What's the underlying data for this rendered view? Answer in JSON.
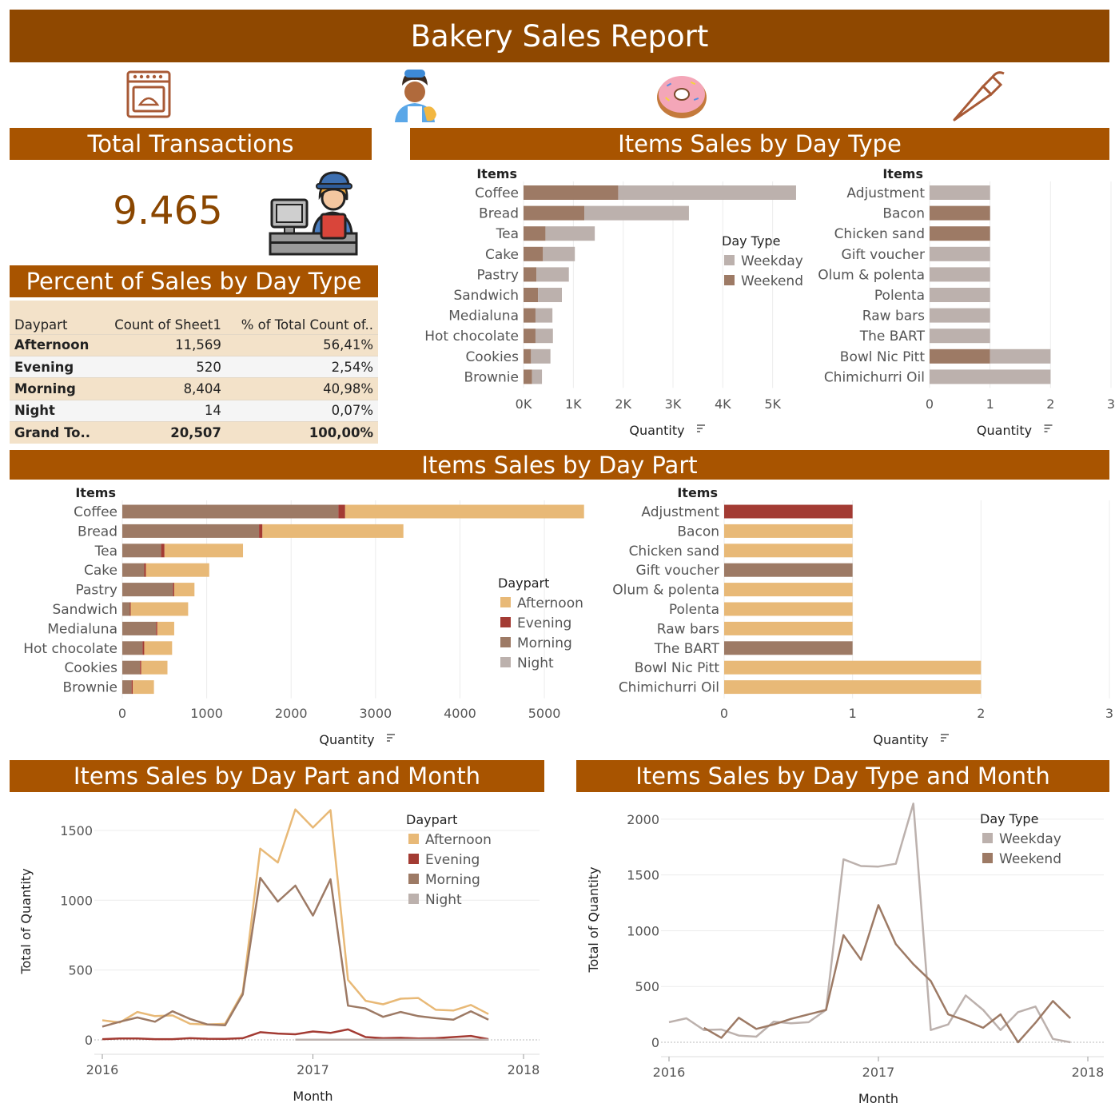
{
  "title": "Bakery Sales Report",
  "icons": [
    "oven-icon",
    "baker-icon",
    "donut-icon",
    "piping-bag-icon",
    "cashier-icon"
  ],
  "colors": {
    "banner": "#a85400",
    "title_banner": "#8f4800",
    "weekday": "#bcb1ad",
    "weekend": "#9d7a65",
    "afternoon": "#e8b977",
    "evening": "#a33b33",
    "morning": "#9d7a65",
    "night": "#bcb1ad"
  },
  "total_transactions": {
    "heading": "Total Transactions",
    "value": "9.465"
  },
  "percent_table": {
    "heading": "Percent of Sales by Day Type",
    "columns": [
      "Daypart",
      "Count of Sheet1",
      "% of Total Count of.."
    ],
    "rows": [
      [
        "Afternoon",
        "11,569",
        "56,41%"
      ],
      [
        "Evening",
        "520",
        "2,54%"
      ],
      [
        "Morning",
        "8,404",
        "40,98%"
      ],
      [
        "Night",
        "14",
        "0,07%"
      ],
      [
        "Grand To..",
        "20,507",
        "100,00%"
      ]
    ]
  },
  "headings": {
    "day_type": "Items Sales by Day Type",
    "day_part": "Items Sales by Day Part",
    "part_month": "Items Sales by Day Part and Month",
    "type_month": "Items Sales by Day Type and Month"
  },
  "chart_data": [
    {
      "id": "daytype-top",
      "type": "bar",
      "orientation": "horizontal",
      "stacked": true,
      "row_header": "Items",
      "categories": [
        "Coffee",
        "Bread",
        "Tea",
        "Cake",
        "Pastry",
        "Sandwich",
        "Medialuna",
        "Hot chocolate",
        "Cookies",
        "Brownie"
      ],
      "series": [
        {
          "name": "Weekend",
          "color_key": "weekend",
          "values": [
            1900,
            1220,
            440,
            390,
            260,
            290,
            240,
            240,
            150,
            170
          ]
        },
        {
          "name": "Weekday",
          "color_key": "weekday",
          "values": [
            3570,
            2100,
            990,
            640,
            650,
            480,
            340,
            350,
            390,
            200
          ]
        }
      ],
      "xlabel": "Quantity",
      "xlim": [
        0,
        6000
      ],
      "ticks": [
        0,
        1000,
        2000,
        3000,
        4000,
        5000
      ],
      "tick_labels": [
        "0K",
        "1K",
        "2K",
        "3K",
        "4K",
        "5K"
      ],
      "legend": {
        "title": "Day Type",
        "entries": [
          "Weekday",
          "Weekend"
        ],
        "placement": "right"
      }
    },
    {
      "id": "daytype-bottom",
      "type": "bar",
      "orientation": "horizontal",
      "stacked": true,
      "row_header": "Items",
      "categories": [
        "Adjustment",
        "Bacon",
        "Chicken sand",
        "Gift voucher",
        "Olum & polenta",
        "Polenta",
        "Raw bars",
        "The BART",
        "Bowl Nic Pitt",
        "Chimichurri Oil"
      ],
      "series": [
        {
          "name": "Weekend",
          "color_key": "weekend",
          "values": [
            0,
            1,
            1,
            0,
            0,
            0,
            0,
            0,
            1,
            0
          ]
        },
        {
          "name": "Weekday",
          "color_key": "weekday",
          "values": [
            1,
            0,
            0,
            1,
            1,
            1,
            1,
            1,
            1,
            2
          ]
        }
      ],
      "xlabel": "Quantity",
      "xlim": [
        0,
        3
      ],
      "ticks": [
        0,
        1,
        2,
        3
      ],
      "tick_labels": [
        "0",
        "1",
        "2",
        "3"
      ]
    },
    {
      "id": "daypart-top",
      "type": "bar",
      "orientation": "horizontal",
      "stacked": true,
      "row_header": "Items",
      "categories": [
        "Coffee",
        "Bread",
        "Tea",
        "Cake",
        "Pastry",
        "Sandwich",
        "Medialuna",
        "Hot chocolate",
        "Cookies",
        "Brownie"
      ],
      "series": [
        {
          "name": "Morning",
          "color_key": "morning",
          "values": [
            2560,
            1620,
            460,
            260,
            600,
            90,
            400,
            240,
            210,
            110
          ]
        },
        {
          "name": "Evening",
          "color_key": "evening",
          "values": [
            80,
            40,
            40,
            20,
            15,
            10,
            15,
            20,
            15,
            15
          ]
        },
        {
          "name": "Afternoon",
          "color_key": "afternoon",
          "values": [
            2830,
            1670,
            930,
            750,
            240,
            680,
            200,
            330,
            310,
            250
          ]
        },
        {
          "name": "Night",
          "color_key": "night",
          "values": [
            0,
            0,
            0,
            0,
            0,
            0,
            0,
            0,
            0,
            0
          ]
        }
      ],
      "xlabel": "Quantity",
      "xlim": [
        0,
        5700
      ],
      "ticks": [
        0,
        1000,
        2000,
        3000,
        4000,
        5000
      ],
      "tick_labels": [
        "0",
        "1000",
        "2000",
        "3000",
        "4000",
        "5000"
      ],
      "legend": {
        "title": "Daypart",
        "entries": [
          "Afternoon",
          "Evening",
          "Morning",
          "Night"
        ],
        "placement": "right"
      }
    },
    {
      "id": "daypart-bottom",
      "type": "bar",
      "orientation": "horizontal",
      "stacked": true,
      "row_header": "Items",
      "categories": [
        "Adjustment",
        "Bacon",
        "Chicken sand",
        "Gift voucher",
        "Olum & polenta",
        "Polenta",
        "Raw bars",
        "The BART",
        "Bowl Nic Pitt",
        "Chimichurri Oil"
      ],
      "series": [
        {
          "name": "Evening",
          "color_key": "evening",
          "values": [
            1,
            0,
            0,
            0,
            0,
            0,
            0,
            0,
            0,
            0
          ]
        },
        {
          "name": "Morning",
          "color_key": "morning",
          "values": [
            0,
            0,
            0,
            1,
            0,
            0,
            0,
            1,
            0,
            0
          ]
        },
        {
          "name": "Afternoon",
          "color_key": "afternoon",
          "values": [
            0,
            1,
            1,
            0,
            1,
            1,
            1,
            0,
            2,
            2
          ]
        }
      ],
      "xlabel": "Quantity",
      "xlim": [
        0,
        3
      ],
      "ticks": [
        0,
        1,
        2,
        3
      ],
      "tick_labels": [
        "0",
        "1",
        "2",
        "3"
      ]
    },
    {
      "id": "part-month",
      "type": "line",
      "x": [
        "2016-01",
        "2016-02",
        "2016-03",
        "2016-04",
        "2016-05",
        "2016-06",
        "2016-07",
        "2016-08",
        "2016-09",
        "2016-10",
        "2016-11",
        "2016-12",
        "2017-01",
        "2017-02",
        "2017-03",
        "2017-04",
        "2017-05",
        "2017-06",
        "2017-07",
        "2017-08",
        "2017-09",
        "2017-10",
        "2017-11",
        "2017-12",
        "2018-01"
      ],
      "series": [
        {
          "name": "Afternoon",
          "color_key": "afternoon",
          "values": [
            140,
            125,
            200,
            170,
            175,
            115,
            110,
            115,
            340,
            1370,
            1270,
            1650,
            1520,
            1645,
            430,
            280,
            255,
            295,
            300,
            215,
            210,
            250,
            185,
            null,
            null
          ]
        },
        {
          "name": "Evening",
          "color_key": "evening",
          "values": [
            5,
            10,
            10,
            5,
            5,
            12,
            8,
            7,
            12,
            55,
            45,
            40,
            60,
            50,
            75,
            20,
            12,
            15,
            10,
            12,
            20,
            28,
            5,
            null,
            null
          ]
        },
        {
          "name": "Morning",
          "color_key": "morning",
          "values": [
            95,
            130,
            160,
            130,
            205,
            150,
            110,
            105,
            325,
            1160,
            990,
            1105,
            890,
            1150,
            245,
            225,
            165,
            200,
            170,
            155,
            145,
            205,
            145,
            null,
            null
          ]
        },
        {
          "name": "Night",
          "color_key": "night",
          "values": [
            null,
            null,
            null,
            null,
            null,
            null,
            null,
            null,
            null,
            null,
            null,
            2,
            2,
            2,
            2,
            2,
            2,
            2,
            2,
            2,
            2,
            2,
            2,
            null,
            null
          ]
        }
      ],
      "xlabel": "Month",
      "ylabel": "Total of Quantity",
      "x_tick_labels": [
        "2016",
        "2017",
        "2018"
      ],
      "ylim": [
        0,
        1700
      ],
      "y_ticks": [
        0,
        500,
        1000,
        1500
      ],
      "legend": {
        "title": "Daypart",
        "entries": [
          "Afternoon",
          "Evening",
          "Morning",
          "Night"
        ],
        "placement": "top-right"
      }
    },
    {
      "id": "type-month",
      "type": "line",
      "x": [
        "2016-01",
        "2016-02",
        "2016-03",
        "2016-04",
        "2016-05",
        "2016-06",
        "2016-07",
        "2016-08",
        "2016-09",
        "2016-10",
        "2016-11",
        "2016-12",
        "2017-01",
        "2017-02",
        "2017-03",
        "2017-04",
        "2017-05",
        "2017-06",
        "2017-07",
        "2017-08",
        "2017-09",
        "2017-10",
        "2017-11",
        "2017-12",
        "2018-01"
      ],
      "series": [
        {
          "name": "Weekday",
          "color_key": "weekday",
          "values": [
            180,
            215,
            110,
            115,
            60,
            50,
            185,
            170,
            180,
            290,
            1640,
            1580,
            1575,
            1600,
            2140,
            110,
            160,
            420,
            290,
            110,
            270,
            320,
            30,
            0,
            null
          ]
        },
        {
          "name": "Weekend",
          "color_key": "weekend",
          "values": [
            null,
            null,
            130,
            40,
            220,
            120,
            160,
            210,
            250,
            290,
            960,
            740,
            1230,
            880,
            700,
            550,
            250,
            195,
            130,
            250,
            0,
            175,
            370,
            215,
            null
          ]
        }
      ],
      "xlabel": "Month",
      "ylabel": "Total of Quantity",
      "x_tick_labels": [
        "2016",
        "2017",
        "2018"
      ],
      "ylim": [
        0,
        2200
      ],
      "y_ticks": [
        0,
        500,
        1000,
        1500,
        2000
      ],
      "legend": {
        "title": "Day Type",
        "entries": [
          "Weekday",
          "Weekend"
        ],
        "placement": "top-right"
      }
    }
  ]
}
